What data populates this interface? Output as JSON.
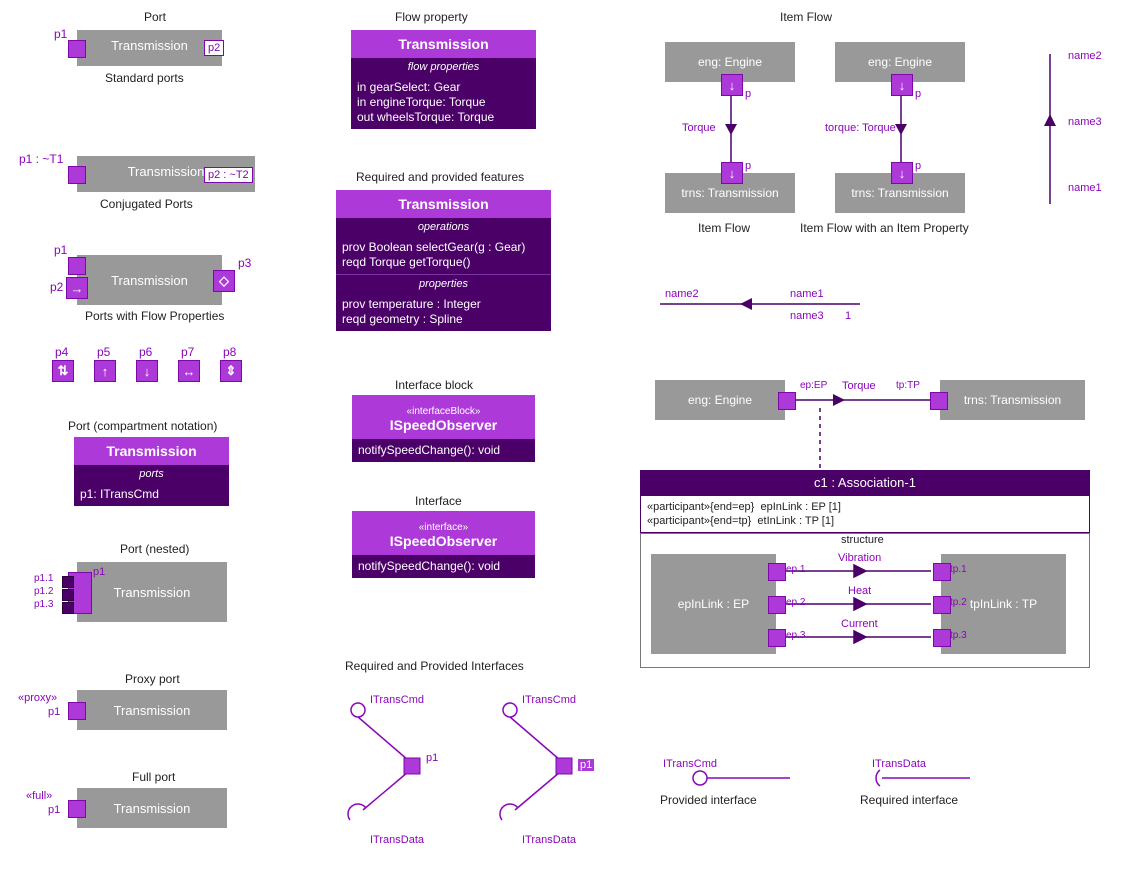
{
  "c1": {
    "port": {
      "title": "Port",
      "block": "Transmission",
      "p1": "p1",
      "p2": "p2",
      "caption": "Standard ports"
    },
    "conj": {
      "block": "Transmission",
      "p1": "p1 : ~T1",
      "p2": "p2 : ~T2",
      "caption": "Conjugated Ports"
    },
    "flow": {
      "block": "Transmission",
      "p1": "p1",
      "p2": "p2",
      "p3": "p3",
      "caption": "Ports with Flow Properties",
      "p4": "p4",
      "p5": "p5",
      "p6": "p6",
      "p7": "p7",
      "p8": "p8"
    },
    "comp": {
      "title": "Port (compartment notation)",
      "name": "Transmission",
      "section": "ports",
      "body": "p1: ITransCmd"
    },
    "nested": {
      "title": "Port (nested)",
      "block": "Transmission",
      "p1": "p1",
      "p11": "p1.1",
      "p12": "p1.2",
      "p13": "p1.3"
    },
    "proxy": {
      "title": "Proxy port",
      "block": "Transmission",
      "p1": "p1",
      "stereo": "«proxy»"
    },
    "full": {
      "title": "Full port",
      "block": "Transmission",
      "p1": "p1",
      "stereo": "«full»"
    }
  },
  "c2": {
    "flow": {
      "title": "Flow property",
      "name": "Transmission",
      "section": "flow properties",
      "body": "in gearSelect: Gear\nin engineTorque: Torque\nout wheelsTorque: Torque"
    },
    "reqprov": {
      "title": "Required and provided features",
      "name": "Transmission",
      "ops_head": "operations",
      "ops": "prov Boolean selectGear(g : Gear)\nreqd Torque getTorque()",
      "props_head": "properties",
      "props": "prov temperature : Integer\nreqd geometry : Spline"
    },
    "ifb": {
      "title": "Interface block",
      "stereo": "«interfaceBlock»",
      "name": "ISpeedObserver",
      "body": "notifySpeedChange(): void"
    },
    "if": {
      "title": "Interface",
      "stereo": "«interface»",
      "name": "ISpeedObserver",
      "body": "notifySpeedChange(): void"
    },
    "lolli": {
      "title": "Required and Provided Interfaces",
      "top": "ITransCmd",
      "bot": "ITransData",
      "port": "p1"
    }
  },
  "c3": {
    "itemflow_title": "Item Flow",
    "if1": {
      "eng": "eng: Engine",
      "trns": "trns: Transmission",
      "p": "p",
      "label": "Torque",
      "caption": "Item Flow"
    },
    "if2": {
      "label": "torque: Torque",
      "caption": "Item Flow with an Item Property"
    },
    "names": {
      "n1": "name1",
      "n2": "name2",
      "n3": "name3",
      "mult": "1"
    },
    "assoc": {
      "ep": "ep:EP",
      "tp": "tp:TP",
      "title": "c1 : Association-1",
      "participants": "«participant»{end=ep}  epInLink : EP [1]\n«participant»{end=tp}  etInLink : TP [1]",
      "structure": "structure",
      "ep_block": "epInLink : EP",
      "tp_block": "tpInLink : TP",
      "rows": [
        "Vibration",
        "Heat",
        "Current"
      ],
      "ports": {
        "ep1": "ep.1",
        "ep2": "ep.2",
        "ep3": "ep.3",
        "tp1": "tp.1",
        "tp2": "tp.2",
        "tp3": "tp.3"
      }
    },
    "prov_caption": "Provided interface",
    "req_caption": "Required interface"
  }
}
